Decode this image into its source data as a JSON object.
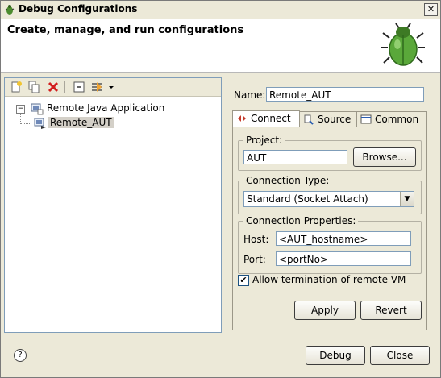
{
  "window": {
    "title": "Debug Configurations",
    "close_glyph": "✕"
  },
  "banner": {
    "title": "Create, manage, and run configurations",
    "icon": "debug-bug-icon"
  },
  "toolbar": {
    "icons": [
      "new-config-icon",
      "duplicate-config-icon",
      "delete-config-icon",
      "collapse-all-icon",
      "filter-icon",
      "dropdown-arrow-icon"
    ]
  },
  "tree": {
    "items": [
      {
        "label": "Remote Java Application",
        "expanded": true
      },
      {
        "label": "Remote_AUT",
        "selected": true
      }
    ]
  },
  "config": {
    "name_label": "Name:",
    "name_value": "Remote_AUT",
    "tabs": [
      {
        "label": "Connect",
        "active": true
      },
      {
        "label": "Source"
      },
      {
        "label": "Common"
      }
    ],
    "project_group": "Project:",
    "project_value": "AUT",
    "browse_label": "Browse...",
    "conn_type_group": "Connection Type:",
    "conn_type_value": "Standard (Socket Attach)",
    "conn_props_group": "Connection Properties:",
    "host_label": "Host:",
    "host_value": "<AUT_hostname>",
    "port_label": "Port:",
    "port_value": "<portNo>",
    "allow_termination_label": "Allow termination of remote VM",
    "allow_termination_checked": true,
    "apply_label": "Apply",
    "revert_label": "Revert"
  },
  "footer": {
    "help_glyph": "?",
    "debug_label": "Debug",
    "close_label": "Close"
  },
  "colors": {
    "accent_blue": "#0a246a",
    "selection": "#d4d0c8"
  }
}
